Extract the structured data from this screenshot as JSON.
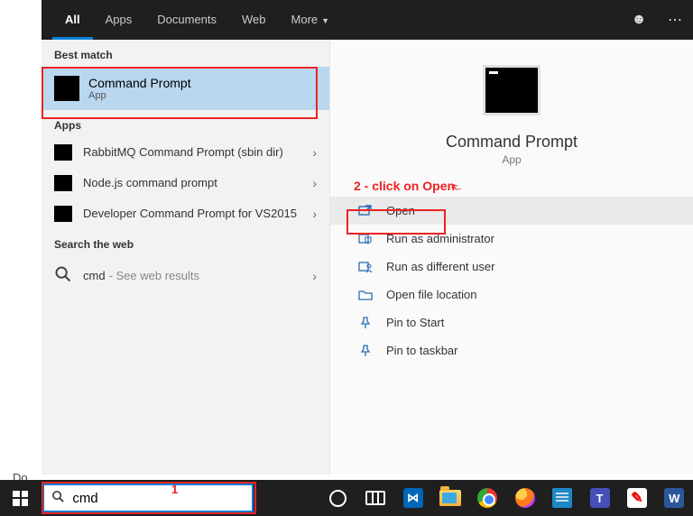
{
  "topbar": {
    "tabs": [
      "All",
      "Apps",
      "Documents",
      "Web",
      "More"
    ],
    "active_index": 0
  },
  "left": {
    "best_match_header": "Best match",
    "best_match": {
      "title": "Command Prompt",
      "subtitle": "App"
    },
    "apps_header": "Apps",
    "apps": [
      {
        "label": "RabbitMQ Command Prompt (sbin dir)"
      },
      {
        "label": "Node.js command prompt"
      },
      {
        "label": "Developer Command Prompt for VS2015"
      }
    ],
    "web_header": "Search the web",
    "web": {
      "query": "cmd",
      "suffix": " - See web results"
    }
  },
  "right": {
    "title": "Command Prompt",
    "subtitle": "App",
    "actions": [
      {
        "id": "open",
        "label": "Open"
      },
      {
        "id": "run-admin",
        "label": "Run as administrator"
      },
      {
        "id": "run-diff",
        "label": "Run as different user"
      },
      {
        "id": "open-loc",
        "label": "Open file location"
      },
      {
        "id": "pin-start",
        "label": "Pin to Start"
      },
      {
        "id": "pin-taskbar",
        "label": "Pin to taskbar"
      }
    ]
  },
  "annotations": {
    "step1": "1",
    "step2": "2 - click on Open"
  },
  "taskbar": {
    "search_value": "cmd",
    "icons": [
      "cortana",
      "taskview",
      "vscode",
      "explorer",
      "chrome",
      "firefox",
      "notepad",
      "teams",
      "acrobat",
      "word"
    ]
  },
  "page_background_text": "Do"
}
